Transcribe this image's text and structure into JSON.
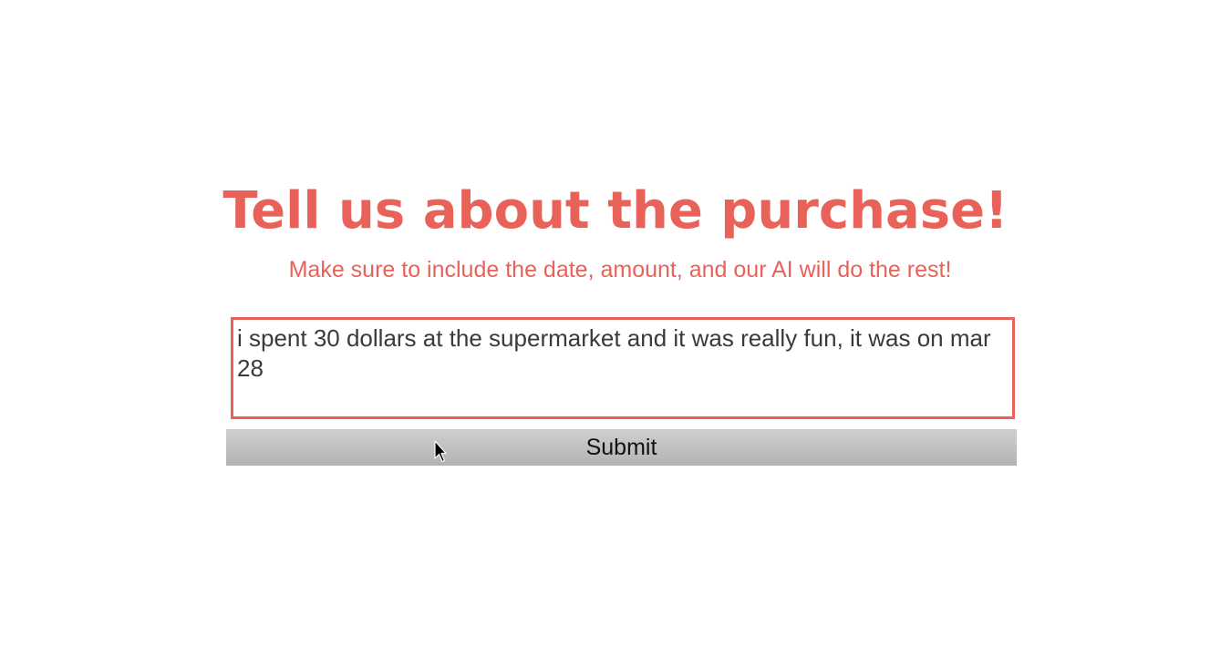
{
  "header": {
    "title": "Tell us about the purchase!",
    "subtitle": "Make sure to include the date, amount, and our AI will do the rest!"
  },
  "form": {
    "description_value": "i spent 30 dollars at the supermarket and it was really fun, it was on mar 28",
    "submit_label": "Submit"
  },
  "colors": {
    "accent": "#e8625a",
    "button": "#bdbdbd",
    "background": "#ffffff"
  },
  "icons": {
    "pointer": "mouse-pointer-icon"
  }
}
